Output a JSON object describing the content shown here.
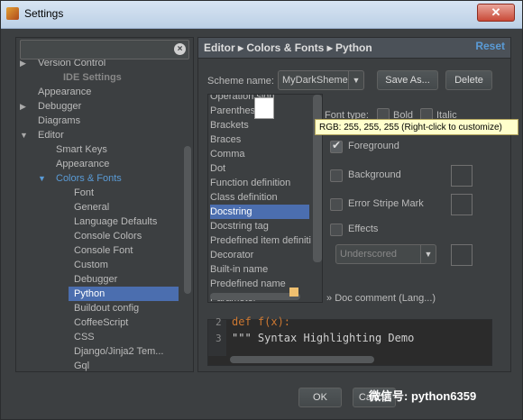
{
  "window": {
    "title": "Settings",
    "close_glyph": "✕"
  },
  "search": {
    "value": "",
    "placeholder": ""
  },
  "tree": {
    "items": [
      {
        "label": "Version Control"
      },
      {
        "label": "IDE Settings"
      },
      {
        "label": "Appearance"
      },
      {
        "label": "Debugger"
      },
      {
        "label": "Diagrams"
      },
      {
        "label": "Editor"
      },
      {
        "label": "Smart Keys"
      },
      {
        "label": "Appearance"
      },
      {
        "label": "Colors & Fonts"
      },
      {
        "label": "Font"
      },
      {
        "label": "General"
      },
      {
        "label": "Language Defaults"
      },
      {
        "label": "Console Colors"
      },
      {
        "label": "Console Font"
      },
      {
        "label": "Custom"
      },
      {
        "label": "Debugger"
      },
      {
        "label": "Python"
      },
      {
        "label": "Buildout config"
      },
      {
        "label": "CoffeeScript"
      },
      {
        "label": "CSS"
      },
      {
        "label": "Django/Jinja2 Tem..."
      },
      {
        "label": "Gql"
      }
    ]
  },
  "header": {
    "breadcrumb": "Editor ▸ Colors & Fonts ▸ Python",
    "reset": "Reset"
  },
  "scheme": {
    "label": "Scheme name:",
    "value": "MyDarkSheme",
    "save_as": "Save As...",
    "delete": "Delete"
  },
  "elements": {
    "items": [
      {
        "label": "Operation sign"
      },
      {
        "label": "Parentheses"
      },
      {
        "label": "Brackets"
      },
      {
        "label": "Braces"
      },
      {
        "label": "Comma"
      },
      {
        "label": "Dot"
      },
      {
        "label": "Function definition"
      },
      {
        "label": "Class definition"
      },
      {
        "label": "Docstring"
      },
      {
        "label": "Docstring tag"
      },
      {
        "label": "Predefined item definiti"
      },
      {
        "label": "Decorator"
      },
      {
        "label": "Built-in name"
      },
      {
        "label": "Predefined name"
      },
      {
        "label": "Parameter"
      }
    ]
  },
  "options": {
    "font_type": "Font type:",
    "bold": "Bold",
    "italic": "Italic",
    "foreground": "Foreground",
    "background": "Background",
    "error_stripe": "Error Stripe Mark",
    "effects": "Effects",
    "effect_type": "Underscored",
    "doc_comment": "Doc comment (Lang...)"
  },
  "tooltip": {
    "text": "RGB: 255, 255, 255 (Right-click to customize)"
  },
  "preview": {
    "lines": [
      {
        "num": "2",
        "text": "def f(x):"
      },
      {
        "num": "3",
        "text": "    \"\"\" Syntax Highlighting Demo"
      }
    ]
  },
  "footer": {
    "ok": "OK",
    "cancel": "Cancel",
    "watermark": "微信号: python6359"
  },
  "colors": {
    "accent": "#4b6eaf",
    "link": "#5a9bd6",
    "tooltip_bg": "#ffffcc"
  }
}
